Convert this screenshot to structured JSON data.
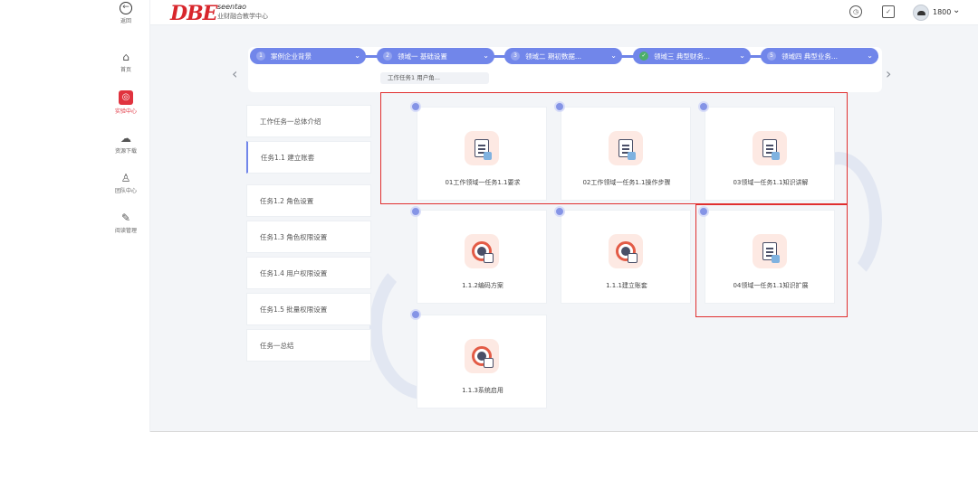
{
  "top": {
    "back_label": "返回",
    "logo_main": "DBE",
    "logo_sub1": "seentao",
    "logo_sub2": "业财融合教学中心",
    "user_name": "1800",
    "clock_icon": "clock-icon",
    "calendar_icon": "calendar-icon"
  },
  "sidebar": [
    {
      "icon": "home-icon",
      "glyph": "⌂",
      "label": "首页"
    },
    {
      "icon": "training-center-icon",
      "glyph": "◎",
      "label": "实验中心",
      "active": true
    },
    {
      "icon": "cloud-download-icon",
      "glyph": "☁",
      "label": "资源下载"
    },
    {
      "icon": "team-icon",
      "glyph": "♙",
      "label": "团队中心"
    },
    {
      "icon": "edit-icon",
      "glyph": "✎",
      "label": "阅读管理"
    }
  ],
  "steps": [
    {
      "num": "1",
      "label": "案例企业背景"
    },
    {
      "num": "2",
      "label": "领域一 基础设置"
    },
    {
      "num": "3",
      "label": "领域二 期初数据..."
    },
    {
      "num": "✓",
      "label": "领域三 典型财务..."
    },
    {
      "num": "5",
      "label": "领域四 典型业务..."
    }
  ],
  "substep": "工作任务1 用户角...",
  "tasks": [
    "工作任务一总体介绍",
    "任务1.1 建立账套",
    "任务1.2 角色设置",
    "任务1.3 角色权限设置",
    "任务1.4 用户权限设置",
    "任务1.5 批量权限设置",
    "任务一总结"
  ],
  "cards": [
    {
      "label": "01工作领域一任务1.1要求",
      "icon": "document-icon"
    },
    {
      "label": "02工作领域一任务1.1操作步骤",
      "icon": "document-icon"
    },
    {
      "label": "03领域一任务1.1知识讲解",
      "icon": "document-icon"
    },
    {
      "label": "1.1.2编码方案",
      "icon": "settings-gear-icon"
    },
    {
      "label": "1.1.1建立账套",
      "icon": "settings-gear-icon"
    },
    {
      "label": "04领域一任务1.1知识扩展",
      "icon": "document-icon"
    },
    {
      "label": "1.1.3系统启用",
      "icon": "settings-gear-icon"
    }
  ],
  "colors": {
    "accent": "#7186ea",
    "brand_red": "#d8262c",
    "highlight_box": "#e02f2f"
  }
}
